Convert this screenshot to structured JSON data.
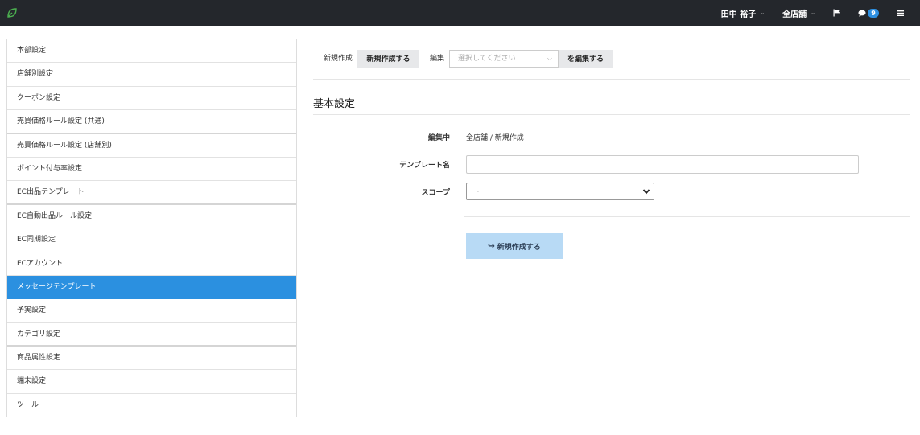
{
  "header": {
    "user_name": "田中 裕子",
    "store": "全店舗",
    "message_count": "9",
    "colors": {
      "bar": "#24272c",
      "logo": "#4caf50",
      "badge": "#2d8fe0"
    }
  },
  "sidebar": {
    "active_color": "#2b90e0",
    "items": [
      {
        "label": "本部設定"
      },
      {
        "label": "店舗別設定"
      },
      {
        "label": "クーポン設定"
      },
      {
        "label": "売買価格ルール設定 (共通)"
      },
      {
        "label": "売買価格ルール設定 (店舗別)"
      },
      {
        "label": "ポイント付与率設定"
      },
      {
        "label": "EC出品テンプレート"
      },
      {
        "label": "EC自動出品ルール設定"
      },
      {
        "label": "EC同期設定"
      },
      {
        "label": "ECアカウント"
      },
      {
        "label": "メッセージテンプレート"
      },
      {
        "label": "予実設定"
      },
      {
        "label": "カテゴリ設定"
      },
      {
        "label": "商品属性設定"
      },
      {
        "label": "端末設定"
      },
      {
        "label": "ツール"
      }
    ]
  },
  "toolbar": {
    "new_label": "新規作成",
    "new_button": "新規作成する",
    "edit_label": "編集",
    "edit_select_placeholder": "選択してください",
    "edit_button": "を編集する"
  },
  "form": {
    "section_title": "基本設定",
    "editing_label": "編集中",
    "editing_value": "全店舗 / 新規作成",
    "template_name_label": "テンプレート名",
    "template_name_value": "",
    "scope_label": "スコープ",
    "scope_value": "-",
    "submit_label": "新規作成する",
    "submit_color": "#b8daf5"
  }
}
